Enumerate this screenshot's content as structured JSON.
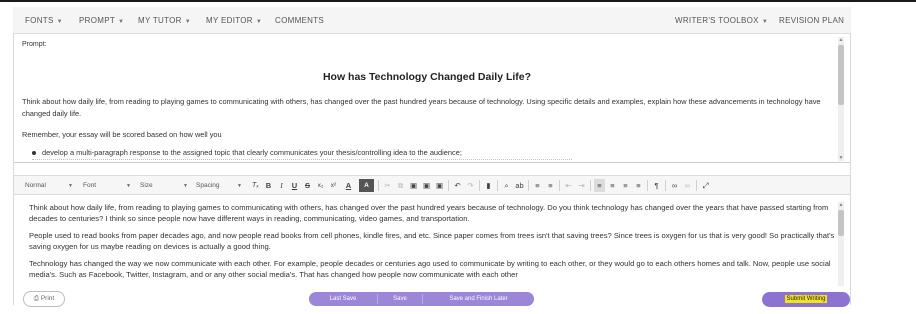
{
  "nav": {
    "left": [
      {
        "label": "FONTS",
        "dropdown": true
      },
      {
        "label": "PROMPT",
        "dropdown": true
      },
      {
        "label": "MY TUTOR",
        "dropdown": true
      },
      {
        "label": "MY EDITOR",
        "dropdown": true
      },
      {
        "label": "COMMENTS",
        "dropdown": false
      }
    ],
    "right": [
      {
        "label": "WRITER'S TOOLBOX",
        "dropdown": true
      },
      {
        "label": "REVISION PLAN",
        "dropdown": false
      }
    ]
  },
  "prompt": {
    "label": "Prompt:",
    "title": "How has Technology Changed Daily Life?",
    "body": "Think about how daily life, from reading to playing games to communicating with others, has changed over the past hundred years because of technology. Using specific details and examples, explain how these advancements in technology have changed daily life.",
    "remember": "Remember, your essay will be scored based on how well you",
    "bullet": "develop a multi-paragraph response to the assigned topic that clearly communicates your thesis/controlling idea to the audience;"
  },
  "toolbar": {
    "style_select": "Normal",
    "font_select": "Font",
    "size_select": "Size",
    "spacing_select": "Spacing",
    "buttons": [
      {
        "name": "clear-format-icon",
        "glyph": "Tₓ"
      },
      {
        "name": "bold-icon",
        "glyph": "B"
      },
      {
        "name": "italic-icon",
        "glyph": "I"
      },
      {
        "name": "underline-icon",
        "glyph": "U"
      },
      {
        "name": "strikethrough-icon",
        "glyph": "S"
      },
      {
        "name": "subscript-icon",
        "glyph": "x₂"
      },
      {
        "name": "superscript-icon",
        "glyph": "x²"
      },
      {
        "name": "text-color-icon",
        "glyph": "A"
      },
      {
        "name": "highlight-color-icon",
        "glyph": "A"
      },
      {
        "name": "cut-icon",
        "glyph": "✂"
      },
      {
        "name": "copy-icon",
        "glyph": "⧉"
      },
      {
        "name": "paste-icon",
        "glyph": "▣"
      },
      {
        "name": "paste-text-icon",
        "glyph": "▣"
      },
      {
        "name": "paste-word-icon",
        "glyph": "▣"
      },
      {
        "name": "undo-icon",
        "glyph": "↶"
      },
      {
        "name": "redo-icon",
        "glyph": "↷"
      },
      {
        "name": "comment-icon",
        "glyph": "▮"
      },
      {
        "name": "find-icon",
        "glyph": "⌕"
      },
      {
        "name": "spellcheck-icon",
        "glyph": "ab"
      },
      {
        "name": "numbered-list-icon",
        "glyph": "≡"
      },
      {
        "name": "bulleted-list-icon",
        "glyph": "≡"
      },
      {
        "name": "outdent-icon",
        "glyph": "⇤"
      },
      {
        "name": "indent-icon",
        "glyph": "⇥"
      },
      {
        "name": "align-left-icon",
        "glyph": "≡"
      },
      {
        "name": "align-center-icon",
        "glyph": "≡"
      },
      {
        "name": "align-right-icon",
        "glyph": "≡"
      },
      {
        "name": "align-justify-icon",
        "glyph": "≡"
      },
      {
        "name": "paragraph-icon",
        "glyph": "¶"
      },
      {
        "name": "link-icon",
        "glyph": "∞"
      },
      {
        "name": "unlink-icon",
        "glyph": "∞"
      },
      {
        "name": "fullscreen-icon",
        "glyph": "⤢"
      }
    ]
  },
  "editor": {
    "paragraphs": [
      "Think about how daily life, from reading to playing games to communicating with others, has changed over the past hundred years because of technology. Do you think technology has changed over the years that have passed starting from decades to centuries? I  think so since people now have different ways in reading, communicating, video games, and transportation.",
      "People used to read books from paper decades ago, and now people read books from cell phones, kindle fires, and etc. Since paper comes from trees isn't that saving trees? Since trees is oxygen for us that is very good! So practically that's saving oxygen for us maybe reading on devices is actually a good thing.",
      "Technology has changed the way we now communicate with each other. For example, people decades or centuries ago used to communicate by writing to each other, or they would go to each others homes and talk. Now, people use social media's. Such as Facebook, Twitter, Instagram, and or any other social media's. That has changed how people now communicate with each other"
    ]
  },
  "footer": {
    "print_label": "Print",
    "last_save_label": "Last Save",
    "save_label": "Save",
    "save_finish_label": "Save and Finish Later",
    "submit_label": "Submit Writing"
  },
  "colors": {
    "save_group": "#9b86d8",
    "submit_button": "#8c73d2",
    "submit_highlight": "#f2e21f",
    "nav_bg": "#f5f5f5",
    "toolbar_bg": "#f6f6f6"
  }
}
